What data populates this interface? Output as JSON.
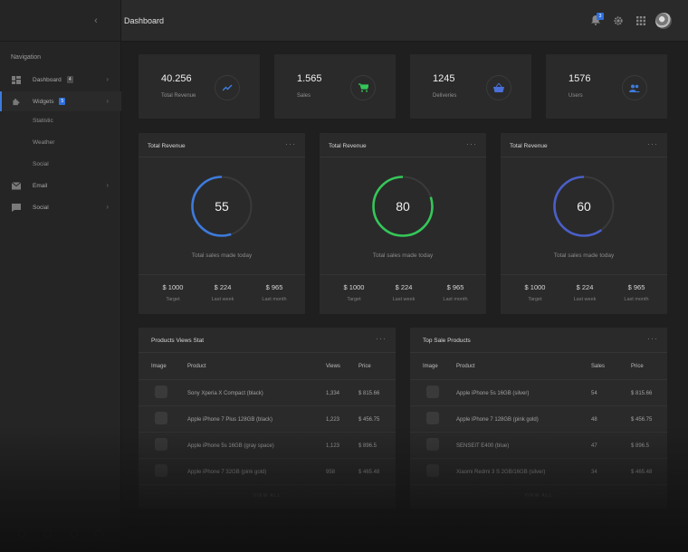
{
  "header": {
    "title": "Dashboard",
    "notification_count": "3"
  },
  "sidebar": {
    "heading": "Navigation",
    "items": [
      {
        "label": "Dashboard",
        "badge": "4",
        "icon": "dashboard-icon"
      },
      {
        "label": "Widgets",
        "badge": "5",
        "icon": "puzzle-icon"
      },
      {
        "label": "Email",
        "icon": "mail-icon"
      },
      {
        "label": "Social",
        "icon": "chat-icon"
      }
    ],
    "subitems": [
      "Statistic",
      "Weather",
      "Social"
    ]
  },
  "stats": [
    {
      "value": "40.256",
      "label": "Total Revenue",
      "icon": "trending-up-icon",
      "color": "#3d7bdc"
    },
    {
      "value": "1.565",
      "label": "Sales",
      "icon": "cart-icon",
      "color": "#34c759"
    },
    {
      "value": "1245",
      "label": "Deliveries",
      "icon": "basket-icon",
      "color": "#4a6fd8"
    },
    {
      "value": "1576",
      "label": "Users",
      "icon": "users-icon",
      "color": "#3d7bdc"
    }
  ],
  "revenue_cards": [
    {
      "title": "Total Revenue",
      "value": "55",
      "percent": 55,
      "color": "#3d7bdc",
      "caption": "Total sales made today",
      "metrics": [
        {
          "value": "$ 1000",
          "label": "Target"
        },
        {
          "value": "$ 224",
          "label": "Last week"
        },
        {
          "value": "$ 965",
          "label": "Last month"
        }
      ]
    },
    {
      "title": "Total Revenue",
      "value": "80",
      "percent": 80,
      "color": "#34c759",
      "caption": "Total sales made today",
      "metrics": [
        {
          "value": "$ 1000",
          "label": "Target"
        },
        {
          "value": "$ 224",
          "label": "Last week"
        },
        {
          "value": "$ 965",
          "label": "Last month"
        }
      ]
    },
    {
      "title": "Total Revenue",
      "value": "60",
      "percent": 60,
      "color": "#4a5fc8",
      "caption": "Total sales made today",
      "metrics": [
        {
          "value": "$ 1000",
          "label": "Target"
        },
        {
          "value": "$ 224",
          "label": "Last week"
        },
        {
          "value": "$ 965",
          "label": "Last month"
        }
      ]
    }
  ],
  "products_views": {
    "title": "Products Views Stat",
    "columns": [
      "Image",
      "Product",
      "Views",
      "Price"
    ],
    "rows": [
      {
        "product": "Sony Xperia X Compact (black)",
        "views": "1,334",
        "price": "$ 815.66"
      },
      {
        "product": "Apple iPhone 7 Plus 128GB (black)",
        "views": "1,223",
        "price": "$ 456.75"
      },
      {
        "product": "Apple iPhone 5s 16GB (gray space)",
        "views": "1,123",
        "price": "$ 896.5"
      },
      {
        "product": "Apple iPhone 7 32GB (pink gold)",
        "views": "958",
        "price": "$ 465.48"
      }
    ],
    "view_all": "VIEW ALL"
  },
  "top_sale": {
    "title": "Top Sale Products",
    "columns": [
      "Image",
      "Product",
      "Sales",
      "Price"
    ],
    "rows": [
      {
        "product": "Apple iPhone 5s 16GB (silver)",
        "sales": "54",
        "price": "$ 815.66"
      },
      {
        "product": "Apple iPhone 7 128GB (pink gold)",
        "sales": "48",
        "price": "$ 456.75"
      },
      {
        "product": "SENSEIT E400 (blue)",
        "sales": "47",
        "price": "$ 896.5"
      },
      {
        "product": "Xiaomi Redmi 3 S 2GB/16GB (silver)",
        "sales": "34",
        "price": "$ 465.48"
      }
    ],
    "view_all": "VIEW ALL"
  }
}
